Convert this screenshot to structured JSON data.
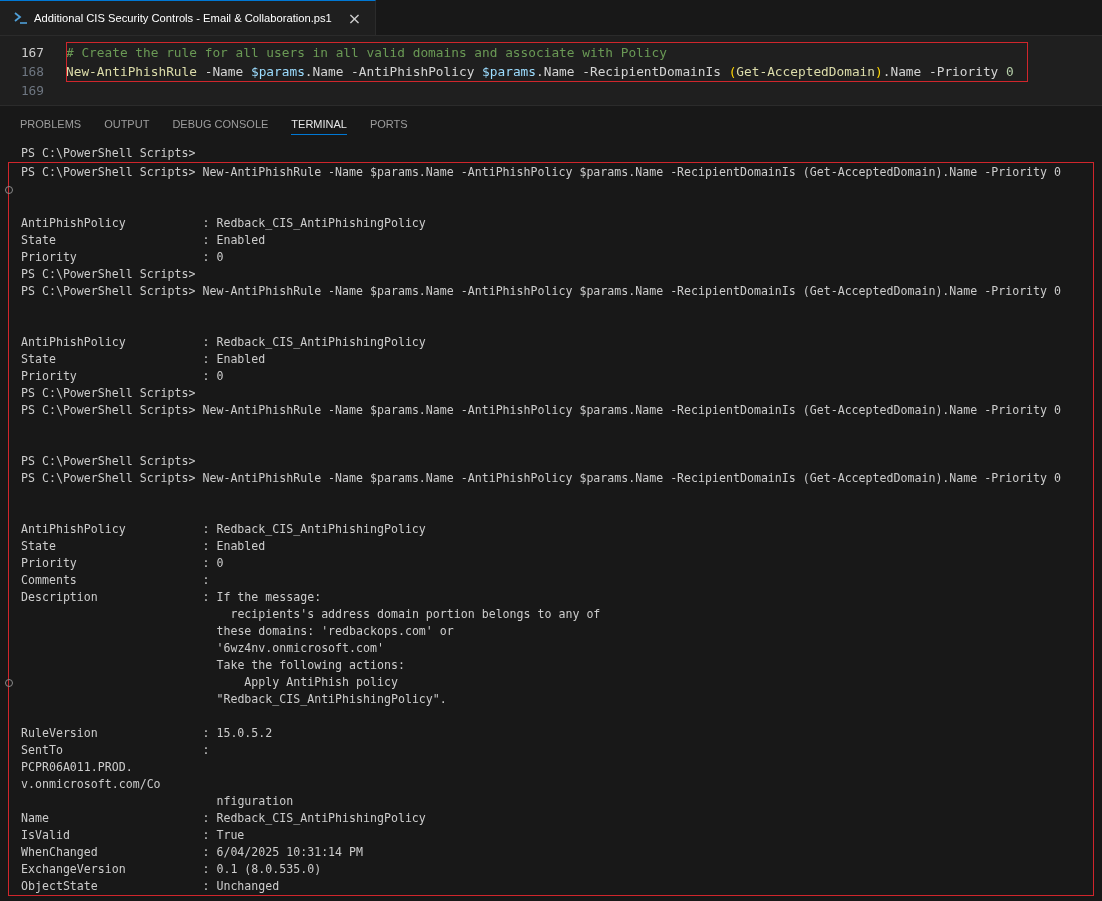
{
  "editor_tab": {
    "title": "Additional CIS Security Controls - Email & Collaboration.ps1",
    "close": "×"
  },
  "editor": {
    "highlighted_lines": [
      {
        "number": "167",
        "current": true,
        "tokens": [
          {
            "kind": "comment",
            "text": "# Create the rule for all users in all valid domains and associate with Policy"
          }
        ]
      },
      {
        "number": "168",
        "current": false,
        "tokens": [
          {
            "kind": "cmdlet",
            "text": "New-AntiPhishRule"
          },
          {
            "kind": "plain",
            "text": " -Name "
          },
          {
            "kind": "variable",
            "text": "$params"
          },
          {
            "kind": "plain",
            "text": ".Name -AntiPhishPolicy "
          },
          {
            "kind": "variable",
            "text": "$params"
          },
          {
            "kind": "plain",
            "text": ".Name -RecipientDomainIs "
          },
          {
            "kind": "bracket",
            "text": "("
          },
          {
            "kind": "cmdlet",
            "text": "Get-AcceptedDomain"
          },
          {
            "kind": "bracket",
            "text": ")"
          },
          {
            "kind": "plain",
            "text": ".Name -Priority "
          },
          {
            "kind": "number",
            "text": "0"
          }
        ]
      }
    ],
    "other_lines": [
      {
        "number": "169",
        "current": false
      }
    ]
  },
  "panel_tabs": [
    {
      "label": "PROBLEMS",
      "selected": false
    },
    {
      "label": "OUTPUT",
      "selected": false
    },
    {
      "label": "DEBUG CONSOLE",
      "selected": false
    },
    {
      "label": "TERMINAL",
      "selected": true
    },
    {
      "label": "PORTS",
      "selected": false
    }
  ],
  "terminal": {
    "first_line": "PS C:\\PowerShell Scripts>",
    "highlighted_lines": [
      {
        "kind": "text",
        "text": "PS C:\\PowerShell Scripts> New-AntiPhishRule -Name $params.Name -AntiPhishPolicy $params.Name -RecipientDomainIs (Get-AcceptedDomain).Name -Priority 0",
        "marked": false
      },
      {
        "kind": "blank",
        "marked": true
      },
      {
        "kind": "blank",
        "marked": false
      },
      {
        "kind": "property",
        "key": "AntiPhishPolicy",
        "value": ": Redback_CIS_AntiPhishingPolicy",
        "marked": false
      },
      {
        "kind": "property",
        "key": "State",
        "value": ": Enabled",
        "marked": false
      },
      {
        "kind": "property",
        "key": "Priority",
        "value": ": 0",
        "marked": false
      },
      {
        "kind": "text",
        "text": "PS C:\\PowerShell Scripts>",
        "marked": false
      },
      {
        "kind": "text",
        "text": "PS C:\\PowerShell Scripts> New-AntiPhishRule -Name $params.Name -AntiPhishPolicy $params.Name -RecipientDomainIs (Get-AcceptedDomain).Name -Priority 0",
        "marked": false
      },
      {
        "kind": "blank",
        "marked": false
      },
      {
        "kind": "blank",
        "marked": false
      },
      {
        "kind": "property",
        "key": "AntiPhishPolicy",
        "value": ": Redback_CIS_AntiPhishingPolicy",
        "marked": false
      },
      {
        "kind": "property",
        "key": "State",
        "value": ": Enabled",
        "marked": false
      },
      {
        "kind": "property",
        "key": "Priority",
        "value": ": 0",
        "marked": false
      },
      {
        "kind": "text",
        "text": "PS C:\\PowerShell Scripts>",
        "marked": false
      },
      {
        "kind": "text",
        "text": "PS C:\\PowerShell Scripts> New-AntiPhishRule -Name $params.Name -AntiPhishPolicy $params.Name -RecipientDomainIs (Get-AcceptedDomain).Name -Priority 0",
        "marked": false
      },
      {
        "kind": "blank",
        "marked": false
      },
      {
        "kind": "blank",
        "marked": false
      },
      {
        "kind": "text",
        "text": "PS C:\\PowerShell Scripts>",
        "marked": false
      },
      {
        "kind": "text",
        "text": "PS C:\\PowerShell Scripts> New-AntiPhishRule -Name $params.Name -AntiPhishPolicy $params.Name -RecipientDomainIs (Get-AcceptedDomain).Name -Priority 0",
        "marked": false
      },
      {
        "kind": "blank",
        "marked": false
      },
      {
        "kind": "blank",
        "marked": false
      },
      {
        "kind": "property",
        "key": "AntiPhishPolicy",
        "value": ": Redback_CIS_AntiPhishingPolicy",
        "marked": false
      },
      {
        "kind": "property",
        "key": "State",
        "value": ": Enabled",
        "marked": false
      },
      {
        "kind": "property",
        "key": "Priority",
        "value": ": 0",
        "marked": false
      },
      {
        "kind": "property",
        "key": "Comments",
        "value": ":",
        "marked": false
      },
      {
        "kind": "property",
        "key": "Description",
        "value": ": If the message:",
        "marked": false
      },
      {
        "kind": "continuation",
        "text": "  recipients's address domain portion belongs to any of",
        "marked": false
      },
      {
        "kind": "continuation",
        "text": "these domains: 'redbackops.com' or",
        "marked": false
      },
      {
        "kind": "continuation",
        "text": "'6wz4nv.onmicrosoft.com'",
        "marked": false
      },
      {
        "kind": "continuation",
        "text": "Take the following actions:",
        "marked": false
      },
      {
        "kind": "continuation",
        "text": "    Apply AntiPhish policy",
        "marked": true
      },
      {
        "kind": "continuation",
        "text": "\"Redback_CIS_AntiPhishingPolicy\".",
        "marked": false
      },
      {
        "kind": "blank",
        "marked": false
      },
      {
        "kind": "property",
        "key": "RuleVersion",
        "value": ": 15.0.5.2",
        "marked": false
      },
      {
        "kind": "property",
        "key": "SentTo",
        "value": ":",
        "marked": false
      },
      {
        "kind": "text",
        "text": "PCPR06A011.PROD.",
        "marked": false
      },
      {
        "kind": "text",
        "text": "v.onmicrosoft.com/Co",
        "marked": false
      },
      {
        "kind": "continuation",
        "text": "nfiguration",
        "marked": false
      },
      {
        "kind": "property",
        "key": "Name",
        "value": ": Redback_CIS_AntiPhishingPolicy",
        "marked": false
      },
      {
        "kind": "property",
        "key": "IsValid",
        "value": ": True",
        "marked": false
      },
      {
        "kind": "property",
        "key": "WhenChanged",
        "value": ": 6/04/2025 10:31:14 PM",
        "marked": false
      },
      {
        "kind": "property",
        "key": "ExchangeVersion",
        "value": ": 0.1 (8.0.535.0)",
        "marked": false
      },
      {
        "kind": "property",
        "key": "ObjectState",
        "value": ": Unchanged",
        "marked": false
      }
    ]
  }
}
